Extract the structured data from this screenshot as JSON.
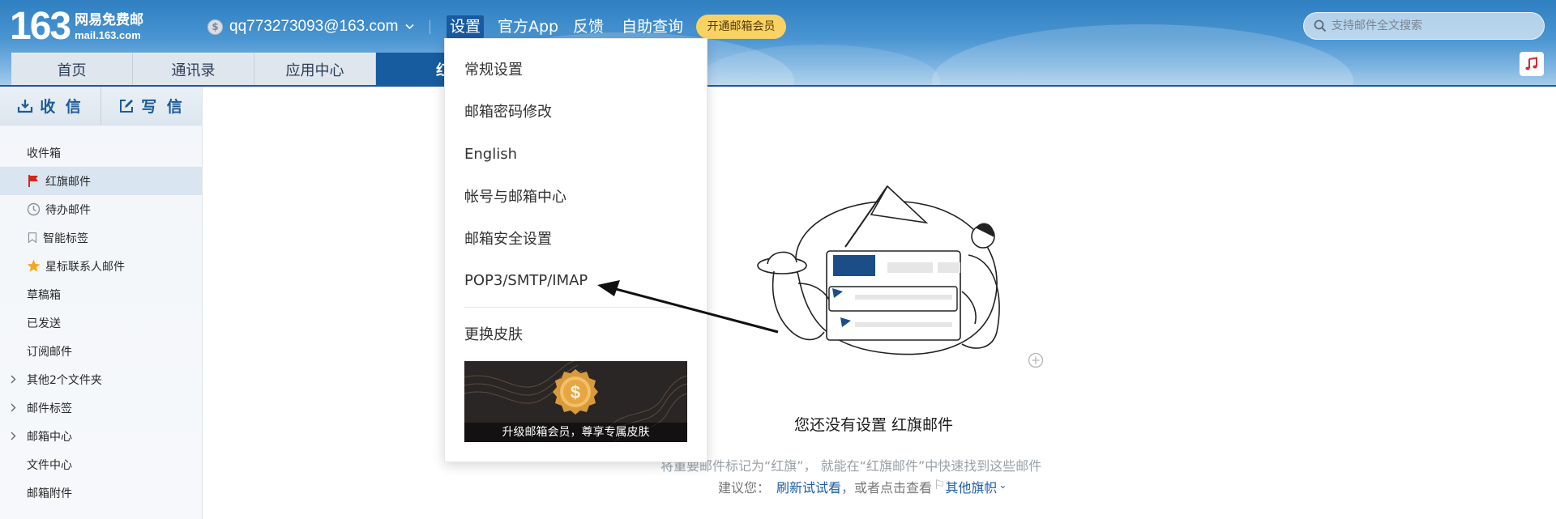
{
  "header": {
    "logo_number": "163",
    "logo_cn": "网易免费邮",
    "logo_url": "mail.163.com",
    "account_email": "qq773273093@163.com",
    "nav": [
      "设置",
      "官方App",
      "反馈",
      "自助查询"
    ],
    "vip_button": "开通邮箱会员",
    "search_placeholder": "支持邮件全文搜索"
  },
  "tabs": [
    "首页",
    "通讯录",
    "应用中心",
    "红旗邮件"
  ],
  "sidebar": {
    "receive": "收 信",
    "compose": "写 信",
    "folders": [
      {
        "label": "收件箱",
        "icon": ""
      },
      {
        "label": "红旗邮件",
        "icon": "red-flag-icon"
      },
      {
        "label": "待办邮件",
        "icon": "clock-icon"
      },
      {
        "label": "智能标签",
        "icon": "bookmark-icon"
      },
      {
        "label": "星标联系人邮件",
        "icon": "star-icon"
      },
      {
        "label": "草稿箱",
        "icon": ""
      },
      {
        "label": "已发送",
        "icon": ""
      },
      {
        "label": "订阅邮件",
        "icon": ""
      },
      {
        "label": "其他2个文件夹",
        "icon": "expand-arrow"
      },
      {
        "label": "邮件标签",
        "icon": "expand-arrow"
      },
      {
        "label": "邮箱中心",
        "icon": "expand-arrow"
      },
      {
        "label": "文件中心",
        "icon": ""
      },
      {
        "label": "邮箱附件",
        "icon": ""
      }
    ]
  },
  "settings_menu": {
    "items": [
      "常规设置",
      "邮箱密码修改",
      "English",
      "帐号与邮箱中心",
      "邮箱安全设置",
      "POP3/SMTP/IMAP",
      "更换皮肤"
    ],
    "banner_text": "升级邮箱会员，尊享专属皮肤"
  },
  "main": {
    "empty_title": "您还没有设置 红旗邮件",
    "empty_desc": "将重要邮件标记为“红旗”， 就能在“红旗邮件”中快速找到这些邮件",
    "suggest_prefix": "建议您：",
    "refresh_link": "刷新试试看",
    "suggest_mid": "，或者点击查看",
    "other_flags": "其他旗帜"
  },
  "colors": {
    "header_blue": "#2f7fc1",
    "active_tab": "#165c9f",
    "vip_yellow": "#f8d364",
    "link_blue": "#1f5ea8"
  }
}
